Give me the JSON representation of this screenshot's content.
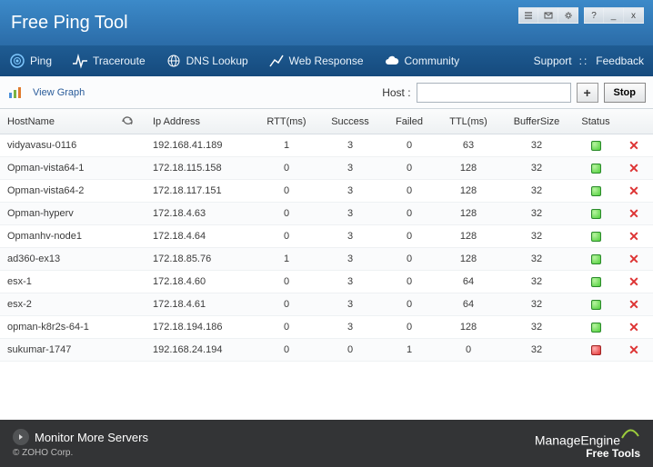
{
  "title": "Free Ping Tool",
  "window_buttons": {
    "help": "?",
    "min": "_",
    "close": "x"
  },
  "toolbar": {
    "items": [
      {
        "label": "Ping"
      },
      {
        "label": "Traceroute"
      },
      {
        "label": "DNS Lookup"
      },
      {
        "label": "Web Response"
      },
      {
        "label": "Community"
      }
    ],
    "support": "Support",
    "feedback": "Feedback"
  },
  "subbar": {
    "view_graph": "View Graph",
    "host_label": "Host  :",
    "host_value": "",
    "host_placeholder": "",
    "add": "+",
    "stop": "Stop"
  },
  "columns": {
    "host": "HostName",
    "ip": "Ip Address",
    "rtt": "RTT(ms)",
    "success": "Success",
    "failed": "Failed",
    "ttl": "TTL(ms)",
    "buffer": "BufferSize",
    "status": "Status"
  },
  "rows": [
    {
      "host": "vidyavasu-0116",
      "ip": "192.168.41.189",
      "rtt": "1",
      "suc": "3",
      "fail": "0",
      "ttl": "63",
      "buf": "32",
      "status": "ok"
    },
    {
      "host": "Opman-vista64-1",
      "ip": "172.18.115.158",
      "rtt": "0",
      "suc": "3",
      "fail": "0",
      "ttl": "128",
      "buf": "32",
      "status": "ok"
    },
    {
      "host": "Opman-vista64-2",
      "ip": "172.18.117.151",
      "rtt": "0",
      "suc": "3",
      "fail": "0",
      "ttl": "128",
      "buf": "32",
      "status": "ok"
    },
    {
      "host": "Opman-hyperv",
      "ip": "172.18.4.63",
      "rtt": "0",
      "suc": "3",
      "fail": "0",
      "ttl": "128",
      "buf": "32",
      "status": "ok"
    },
    {
      "host": "Opmanhv-node1",
      "ip": "172.18.4.64",
      "rtt": "0",
      "suc": "3",
      "fail": "0",
      "ttl": "128",
      "buf": "32",
      "status": "ok"
    },
    {
      "host": "ad360-ex13",
      "ip": "172.18.85.76",
      "rtt": "1",
      "suc": "3",
      "fail": "0",
      "ttl": "128",
      "buf": "32",
      "status": "ok"
    },
    {
      "host": "esx-1",
      "ip": "172.18.4.60",
      "rtt": "0",
      "suc": "3",
      "fail": "0",
      "ttl": "64",
      "buf": "32",
      "status": "ok"
    },
    {
      "host": "esx-2",
      "ip": "172.18.4.61",
      "rtt": "0",
      "suc": "3",
      "fail": "0",
      "ttl": "64",
      "buf": "32",
      "status": "ok"
    },
    {
      "host": "opman-k8r2s-64-1",
      "ip": "172.18.194.186",
      "rtt": "0",
      "suc": "3",
      "fail": "0",
      "ttl": "128",
      "buf": "32",
      "status": "ok"
    },
    {
      "host": "sukumar-1747",
      "ip": "192.168.24.194",
      "rtt": "0",
      "suc": "0",
      "fail": "1",
      "ttl": "0",
      "buf": "32",
      "status": "fail"
    }
  ],
  "footer": {
    "monitor": "Monitor More Servers",
    "copy": "© ZOHO Corp.",
    "brand1": "ManageEngine",
    "brand2": "Free Tools"
  }
}
